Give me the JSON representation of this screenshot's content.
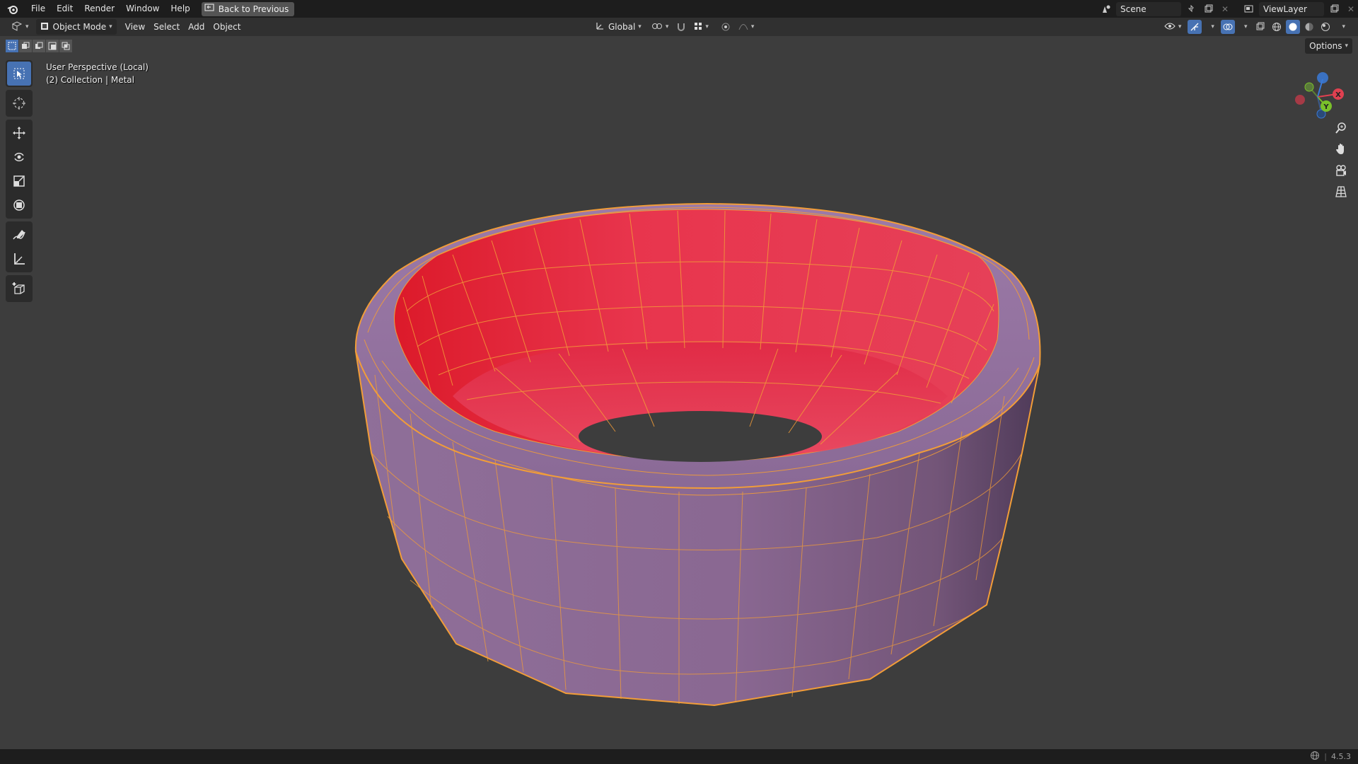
{
  "menu": {
    "file": "File",
    "edit": "Edit",
    "render": "Render",
    "window": "Window",
    "help": "Help",
    "back_to_previous": "Back to Previous"
  },
  "scene": {
    "name": "Scene"
  },
  "view_layer": {
    "name": "ViewLayer"
  },
  "header": {
    "mode": "Object Mode",
    "view": "View",
    "select": "Select",
    "add": "Add",
    "object": "Object",
    "transform_orientation": "Global"
  },
  "viewport": {
    "perspective": "User Perspective (Local)",
    "collection_info": "(2) Collection | Metal",
    "options": "Options"
  },
  "gizmo": {
    "x": "X",
    "y": "Y",
    "z": "Z"
  },
  "status": {
    "version": "4.5.3"
  },
  "colors": {
    "accent": "#4772b3",
    "outline": "#f29d38",
    "inner_face": "#e8354d",
    "outer_face": "#8a6891",
    "axis_x": "#e04050",
    "axis_y": "#7ac02a",
    "axis_z": "#3a7ad8"
  }
}
